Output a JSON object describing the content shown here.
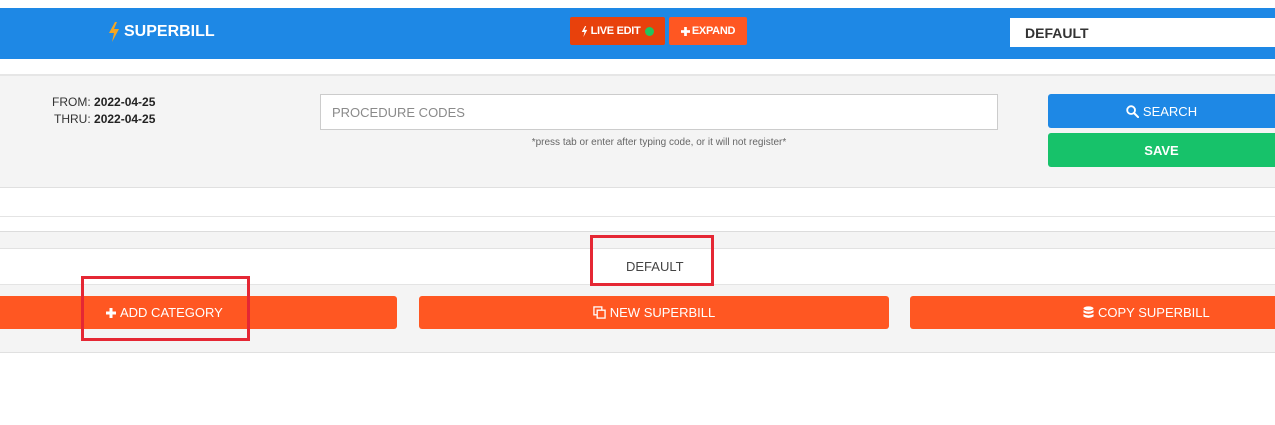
{
  "header": {
    "brand": "SUPERBILL",
    "live_edit_label": "LIVE EDIT",
    "expand_label": "EXPAND",
    "profile_value": "DEFAULT"
  },
  "filters": {
    "from_label": "FROM:",
    "from_value": "2022-04-25",
    "thru_label": "THRU:",
    "thru_value": "2022-04-25",
    "procedure_placeholder": "PROCEDURE CODES",
    "procedure_value": "",
    "hint": "*press tab or enter after typing code, or it will not register*",
    "search_label": "SEARCH",
    "save_label": "SAVE"
  },
  "superbill": {
    "name": "DEFAULT"
  },
  "actions": {
    "add_category_label": "ADD CATEGORY",
    "new_superbill_label": "NEW SUPERBILL",
    "copy_superbill_label": "COPY SUPERBILL"
  },
  "colors": {
    "header_blue": "#1e88e5",
    "orange": "#ff5722",
    "live_edit_red": "#e8410c",
    "save_green": "#17c26a",
    "highlight_red": "#e52734",
    "brand_bolt": "#f5a623"
  },
  "icons": {
    "brand": "lightning-bolt-icon",
    "live_status": "green-dot-icon",
    "expand": "plus-icon",
    "search": "magnifier-icon",
    "add": "plus-icon",
    "new": "copy-icon",
    "copy": "database-icon"
  }
}
